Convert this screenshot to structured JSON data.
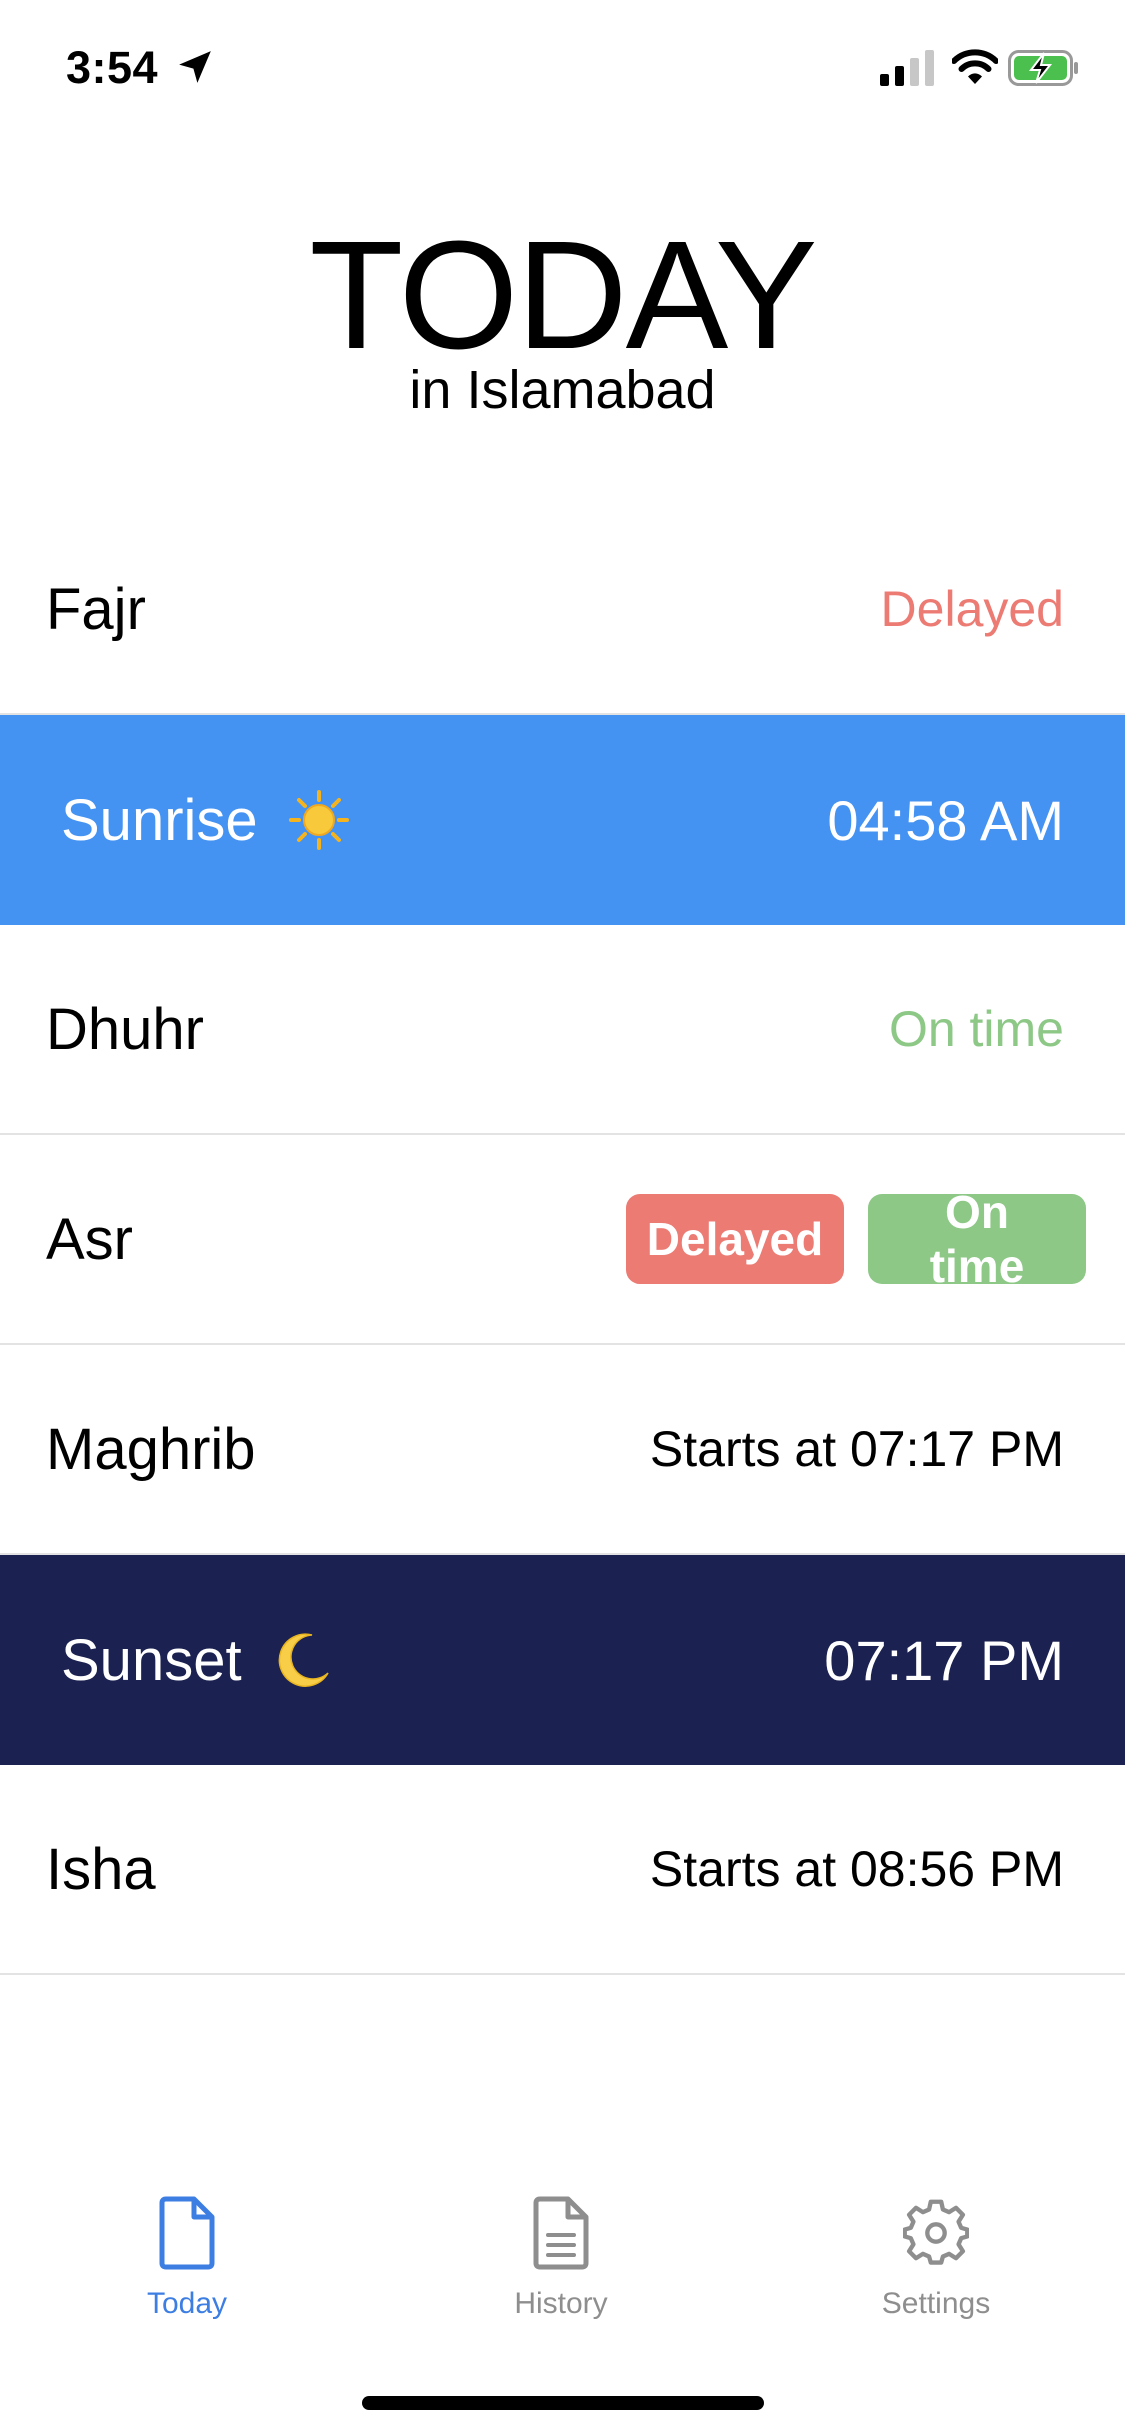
{
  "status_bar": {
    "time": "3:54"
  },
  "header": {
    "title": "TODAY",
    "subtitle": "in Islamabad"
  },
  "prayers": [
    {
      "name": "Fajr",
      "value": "Delayed"
    },
    {
      "name": "Sunrise",
      "value": "04:58 AM"
    },
    {
      "name": "Dhuhr",
      "value": "On time"
    },
    {
      "name": "Asr",
      "delayed_label": "Delayed",
      "ontime_label": "On time"
    },
    {
      "name": "Maghrib",
      "value": "Starts at 07:17 PM"
    },
    {
      "name": "Sunset",
      "value": "07:17 PM"
    },
    {
      "name": "Isha",
      "value": "Starts at 08:56 PM"
    }
  ],
  "tabs": [
    {
      "label": "Today",
      "icon": "document-icon",
      "active": true
    },
    {
      "label": "History",
      "icon": "document-lines-icon",
      "active": false
    },
    {
      "label": "Settings",
      "icon": "gear-icon",
      "active": false
    }
  ],
  "colors": {
    "sunrise_bg": "#4493f2",
    "sunset_bg": "#1b2150",
    "delayed": "#ec7b74",
    "on_time": "#8dc887",
    "active_tab": "#3d7ee3",
    "inactive_tab": "#8e8e8e"
  }
}
